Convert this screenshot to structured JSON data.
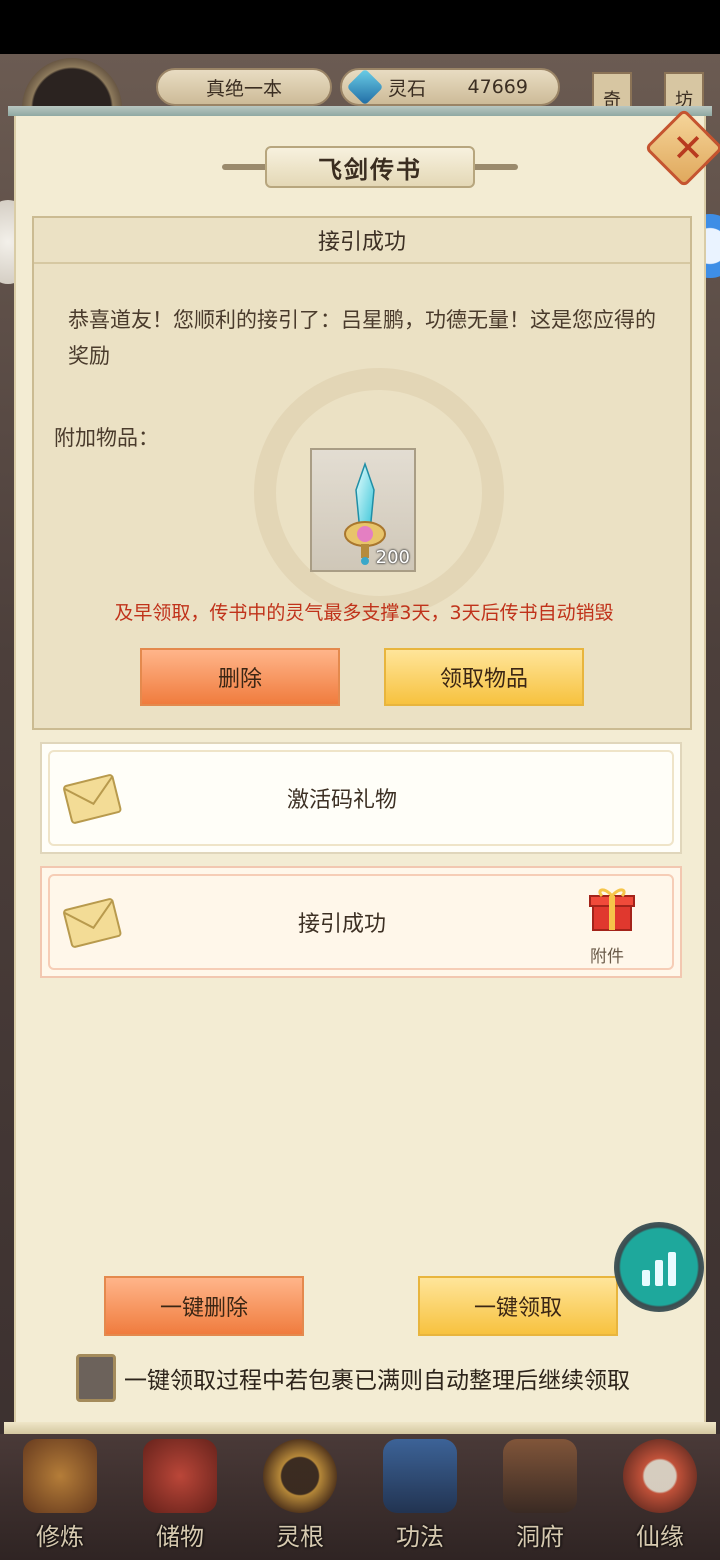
{
  "topbar": {
    "player_name": "真绝一本",
    "currency_label": "灵石",
    "currency_value": "47669",
    "side_tags": [
      "奇",
      "坊"
    ]
  },
  "panel": {
    "title": "飞剑传书",
    "close_icon": "close-icon"
  },
  "detail": {
    "heading": "接引成功",
    "message": "恭喜道友！您顺利的接引了：吕星鹏，功德无量！这是您应得的奖励",
    "attachments_label": "附加物品：",
    "item": {
      "icon": "sword-icon",
      "count": "200"
    },
    "warning": "及早领取，传书中的灵气最多支撑3天，3天后传书自动销毁",
    "delete_label": "删除",
    "claim_label": "领取物品"
  },
  "mail_list": [
    {
      "title": "激活码礼物",
      "has_attachment": false
    },
    {
      "title": "接引成功",
      "has_attachment": true,
      "attachment_tag": "附件"
    }
  ],
  "bulk": {
    "delete_all_label": "一键删除",
    "claim_all_label": "一键领取",
    "auto_sort_label": "一键领取过程中若包裹已满则自动整理后继续领取",
    "auto_sort_checked": false
  },
  "nav": [
    {
      "label": "修炼",
      "icon": "cultivate-icon"
    },
    {
      "label": "储物",
      "icon": "storage-bag-icon"
    },
    {
      "label": "灵根",
      "icon": "spirit-root-icon"
    },
    {
      "label": "功法",
      "icon": "technique-book-icon"
    },
    {
      "label": "洞府",
      "icon": "cave-dwelling-icon"
    },
    {
      "label": "仙缘",
      "icon": "immortal-fate-icon"
    }
  ],
  "colors": {
    "panel_bg": "#f3ecd3",
    "warning": "#c0321a",
    "orange_button": "#f07c3e",
    "yellow_button": "#f7c23f",
    "stats_button": "#1ea89c"
  }
}
